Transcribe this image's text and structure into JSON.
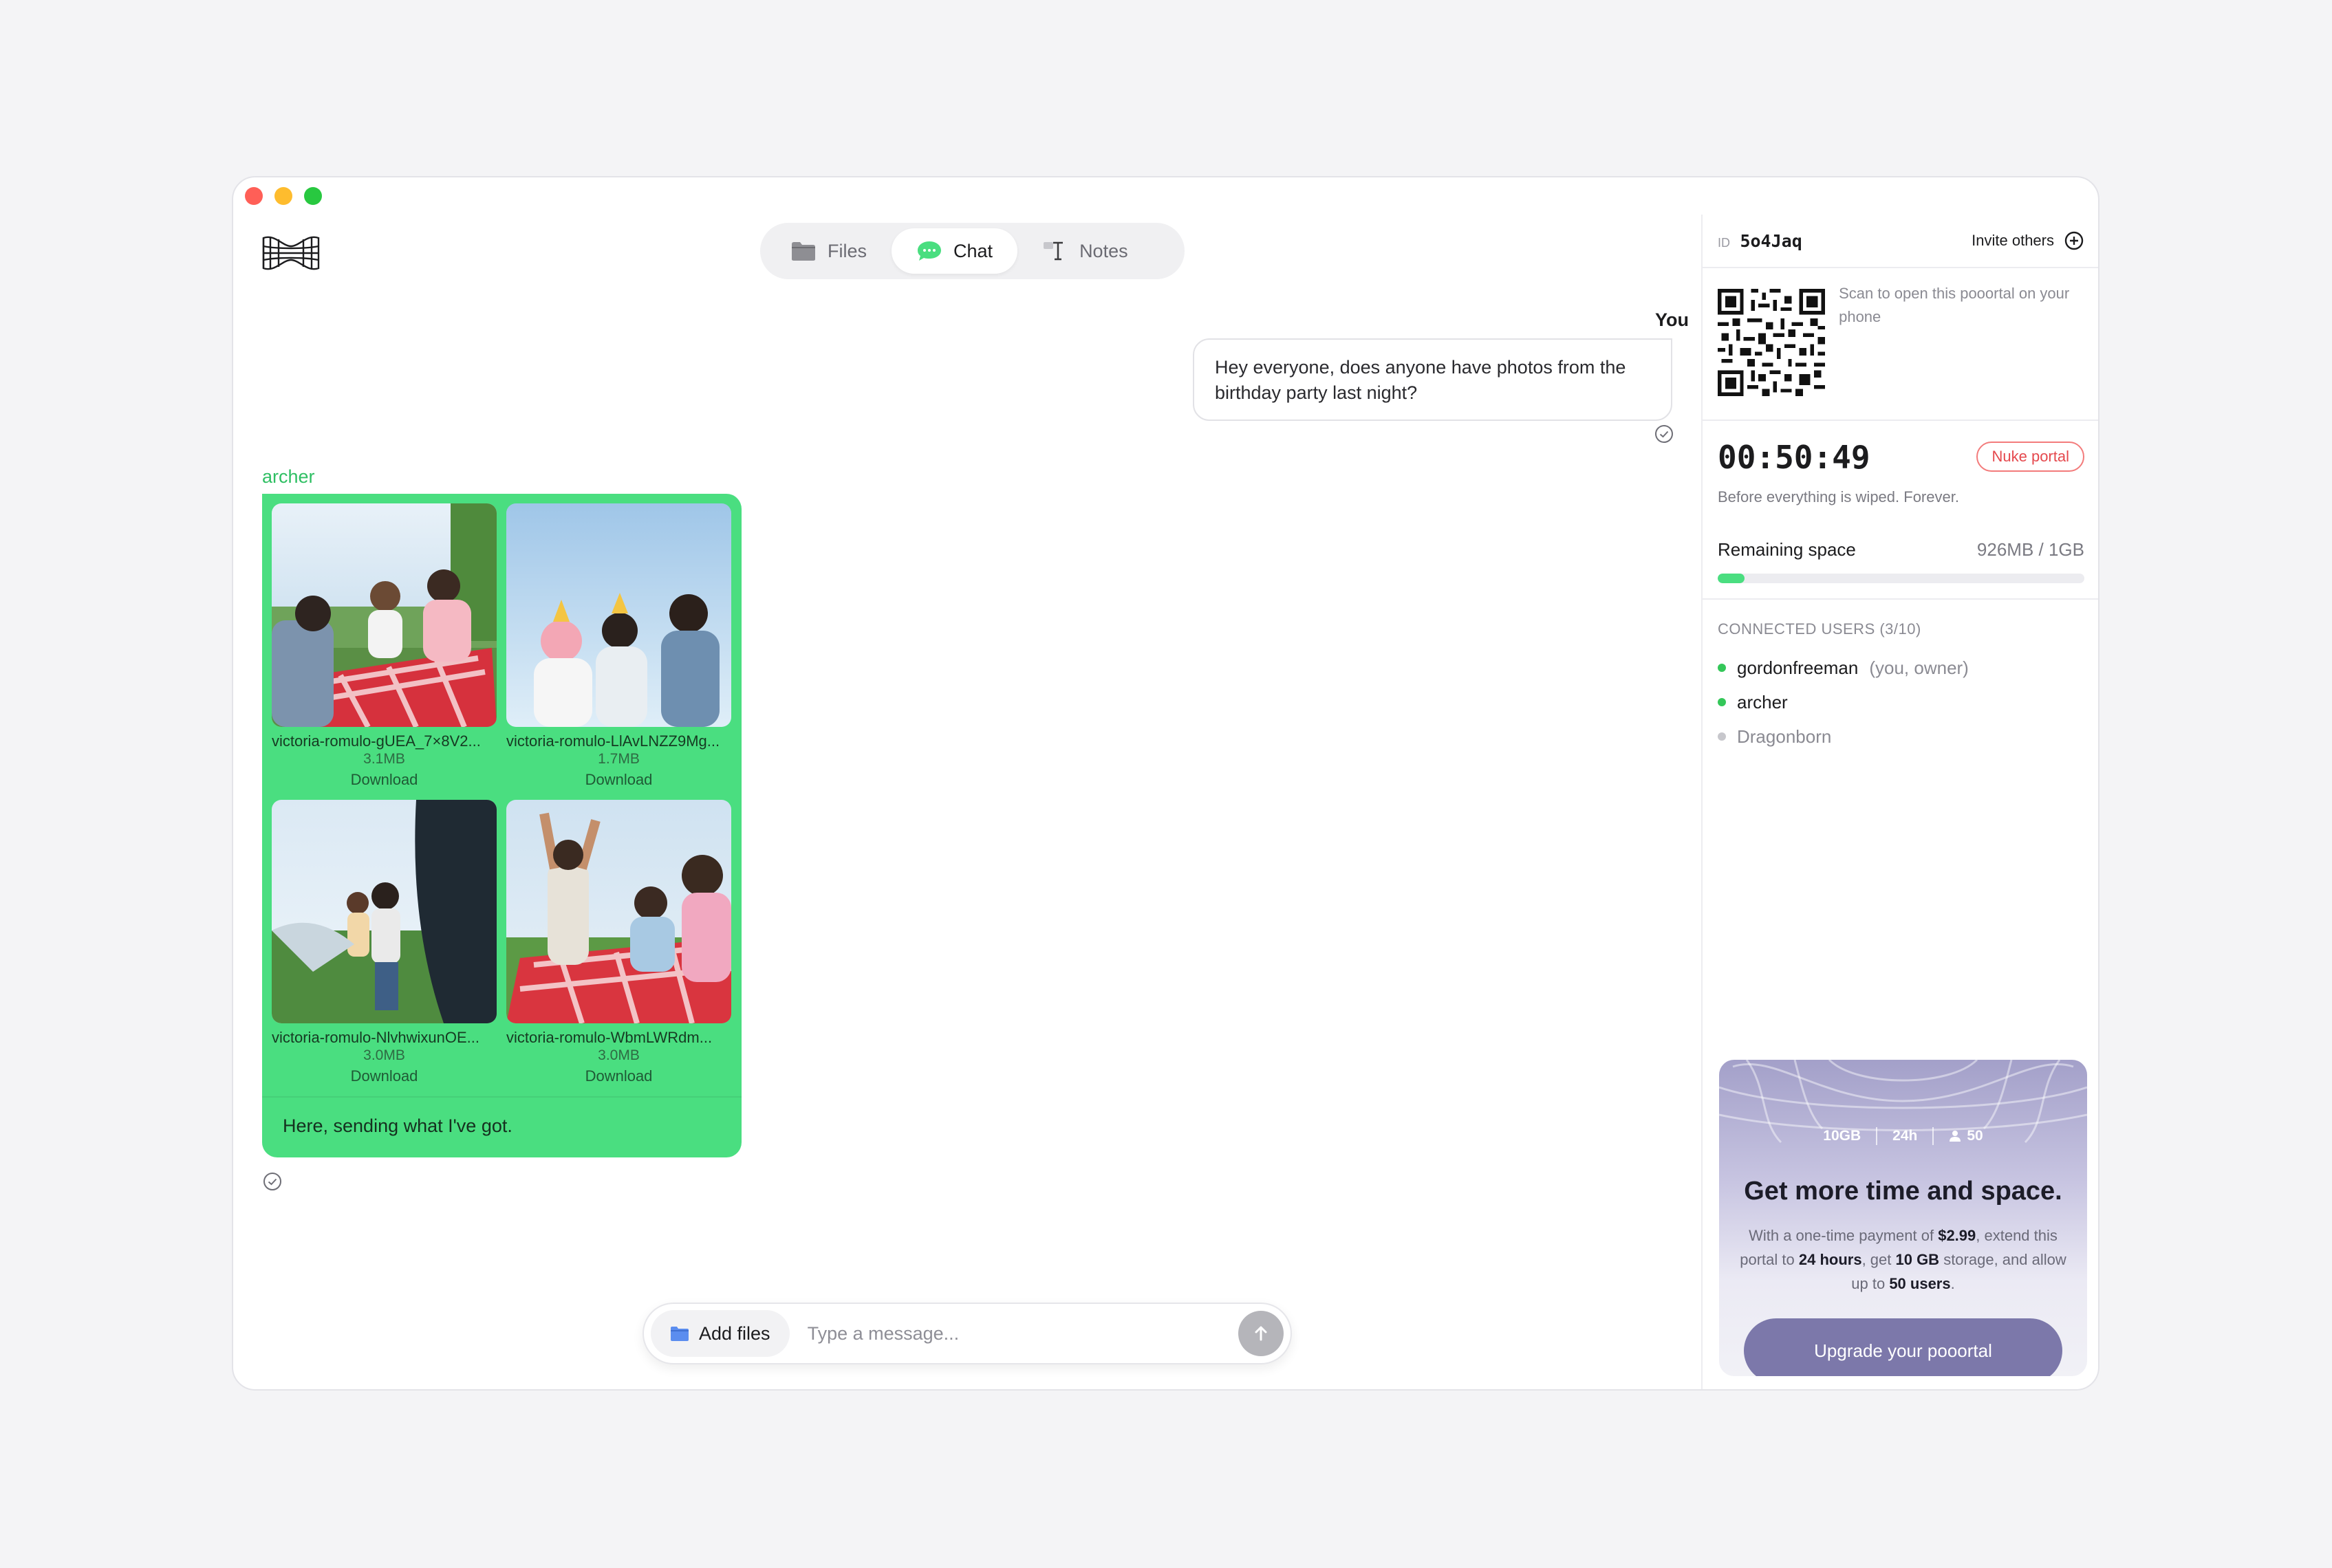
{
  "tabs": [
    {
      "label": "Files",
      "icon": "folder-icon",
      "active": false
    },
    {
      "label": "Chat",
      "icon": "chat-bubble-icon",
      "active": true
    },
    {
      "label": "Notes",
      "icon": "text-cursor-icon",
      "active": false
    }
  ],
  "chat": {
    "you_label": "You",
    "you_message": "Hey everyone, does anyone have photos from the birthday party last night?",
    "archer_label": "archer",
    "archer_message": "Here, sending what I've got.",
    "files": [
      {
        "name": "victoria-romulo-gUEA_7×8V2...",
        "size": "3.1MB",
        "action": "Download"
      },
      {
        "name": "victoria-romulo-LlAvLNZZ9Mg...",
        "size": "1.7MB",
        "action": "Download"
      },
      {
        "name": "victoria-romulo-NlvhwixunOE...",
        "size": "3.0MB",
        "action": "Download"
      },
      {
        "name": "victoria-romulo-WbmLWRdm...",
        "size": "3.0MB",
        "action": "Download"
      }
    ]
  },
  "composer": {
    "add_files_label": "Add files",
    "placeholder": "Type a message..."
  },
  "sidebar": {
    "id_label": "ID",
    "id_value": "5o4Jaq",
    "invite_label": "Invite others",
    "qr_text": "Scan to open this pooortal on your phone",
    "timer": "00:50:49",
    "nuke_label": "Nuke portal",
    "timer_sub": "Before everything is wiped. Forever.",
    "space_label": "Remaining space",
    "space_value": "926MB / 1GB",
    "space_used_fraction": 0.074,
    "users_header": "CONNECTED USERS (3/10)",
    "users": [
      {
        "name": "gordonfreeman",
        "meta": "(you, owner)",
        "online": true
      },
      {
        "name": "archer",
        "meta": "",
        "online": true
      },
      {
        "name": "Dragonborn",
        "meta": "",
        "online": false
      }
    ]
  },
  "promo": {
    "stat_storage": "10GB",
    "stat_time": "24h",
    "stat_users": "50",
    "title": "Get more time and space.",
    "body_1": "With a one-time payment of ",
    "price": "$2.99",
    "body_2": ", extend this portal to ",
    "hours": "24 hours",
    "body_3": ", get ",
    "storage": "10 GB",
    "body_4": " storage, and allow up to ",
    "users": "50 users",
    "body_5": ".",
    "button_label": "Upgrade your pooortal"
  },
  "colors": {
    "accent_green": "#4ade80",
    "danger": "#e5484d",
    "upgrade_button": "#7c78aa"
  }
}
